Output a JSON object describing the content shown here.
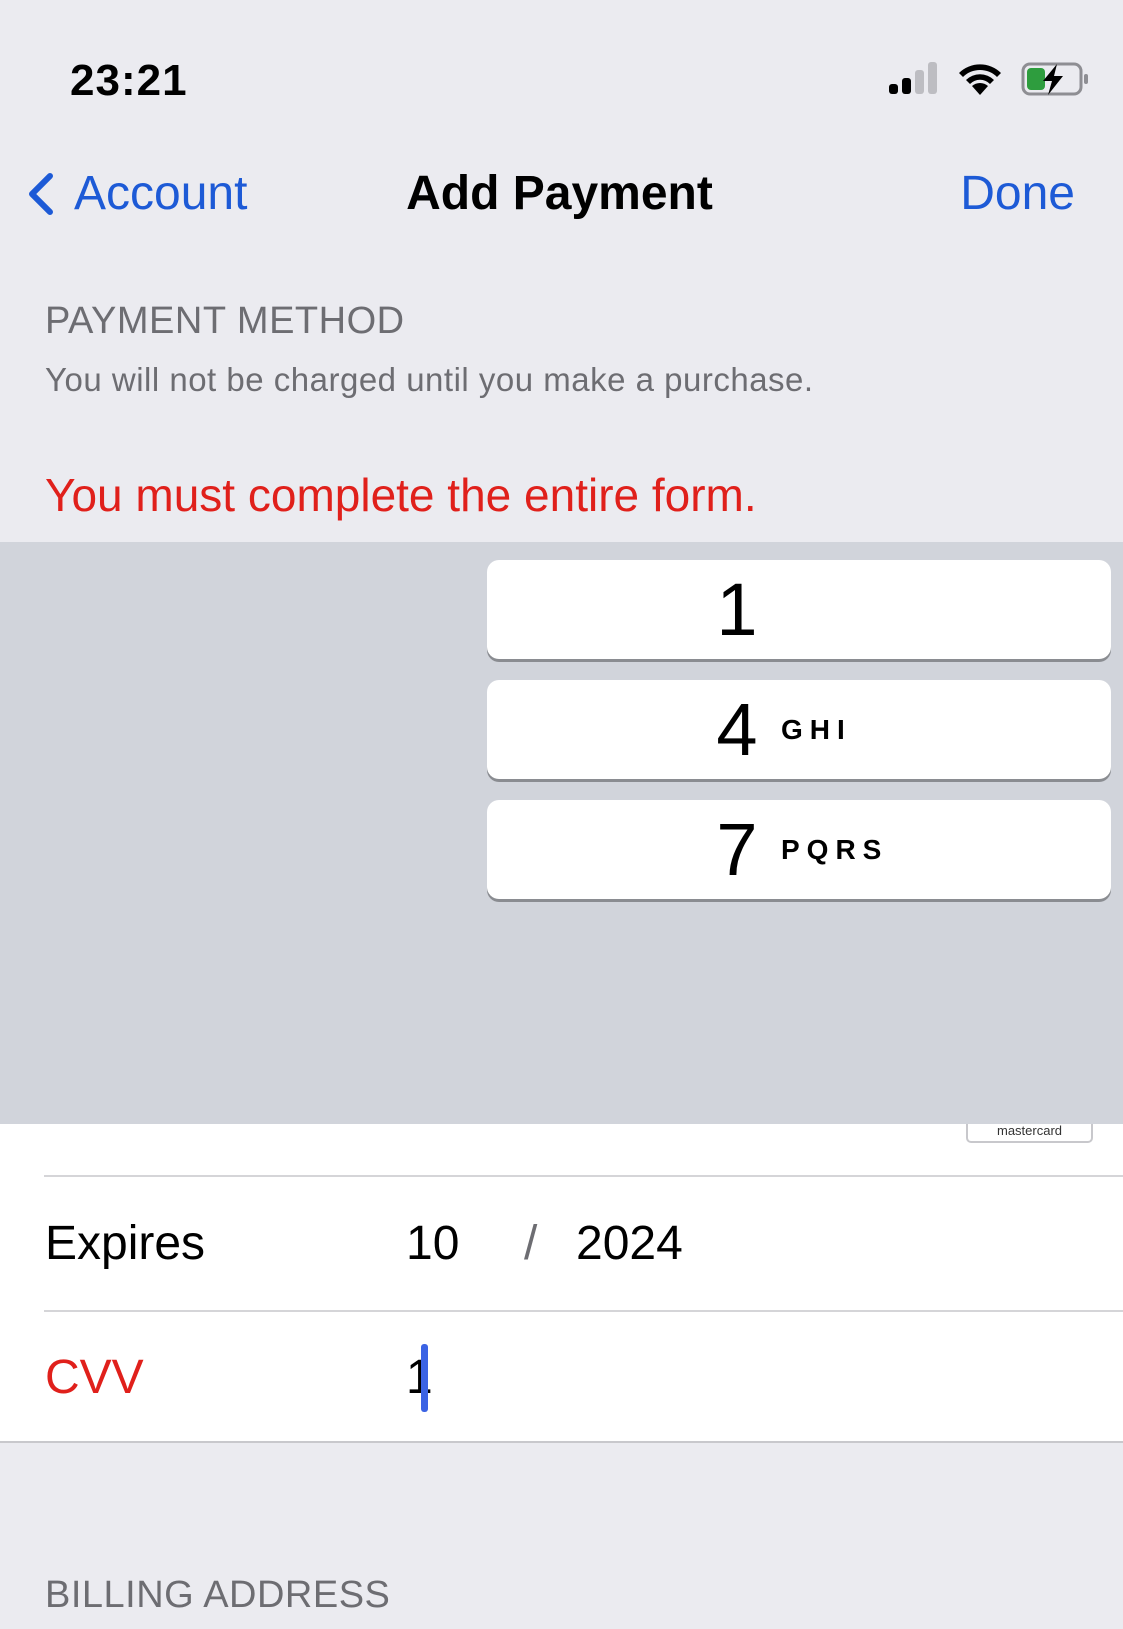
{
  "status_bar": {
    "time": "23:21",
    "icons": [
      "cellular-signal-icon",
      "wifi-icon",
      "battery-charging-icon"
    ],
    "battery_color": "#2e9d3e"
  },
  "nav": {
    "back_label": "Account",
    "title": "Add Payment",
    "done_label": "Done",
    "accent": "#1d5ad6"
  },
  "payment_method": {
    "header": "PAYMENT METHOD",
    "subtitle": "You will not be charged until you make a purchase.",
    "error": "You must complete the entire form.",
    "error_color": "#e0201b"
  },
  "keypad": {
    "keys": [
      {
        "digit": "1",
        "letters": ""
      },
      {
        "digit": "4",
        "letters": "GHI"
      },
      {
        "digit": "7",
        "letters": "PQRS"
      }
    ]
  },
  "form": {
    "card_brand": "mastercard",
    "expires_label": "Expires",
    "expires_month": "10",
    "expires_sep": "/",
    "expires_year": "2024",
    "cvv_label": "CVV",
    "cvv_value": "1"
  },
  "billing": {
    "header": "BILLING ADDRESS"
  }
}
